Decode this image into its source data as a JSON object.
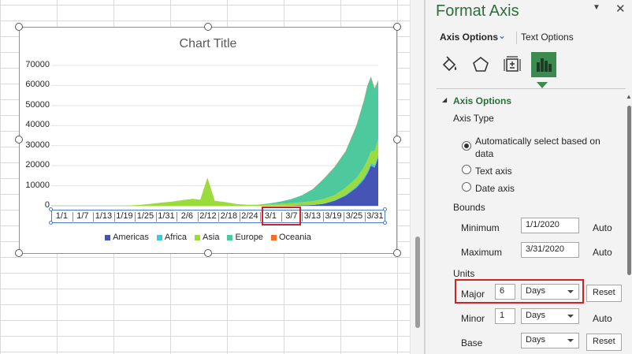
{
  "chart": {
    "title": "Chart Title",
    "y_ticks": [
      "70000",
      "60000",
      "50000",
      "40000",
      "30000",
      "20000",
      "10000",
      "0"
    ],
    "x_ticks": [
      "1/1",
      "1/7",
      "1/13",
      "1/19",
      "1/25",
      "1/31",
      "2/6",
      "2/12",
      "2/18",
      "2/24",
      "3/1",
      "3/7",
      "3/13",
      "3/19",
      "3/25",
      "3/31"
    ],
    "legend": [
      {
        "name": "Americas",
        "color": "#4655b5"
      },
      {
        "name": "Africa",
        "color": "#45c3e6"
      },
      {
        "name": "Asia",
        "color": "#9bdc3c"
      },
      {
        "name": "Europe",
        "color": "#4ec89d"
      },
      {
        "name": "Oceania",
        "color": "#f0702c"
      }
    ],
    "highlighted_ticks": [
      "3/1",
      "3/7"
    ]
  },
  "chart_data": {
    "type": "area",
    "title": "Chart Title",
    "xlabel": "",
    "ylabel": "",
    "ylim": [
      0,
      70000
    ],
    "x": [
      "1/1",
      "1/4",
      "1/7",
      "1/10",
      "1/13",
      "1/16",
      "1/19",
      "1/22",
      "1/25",
      "1/28",
      "1/31",
      "2/3",
      "2/6",
      "2/9",
      "2/11",
      "2/13",
      "2/15",
      "2/18",
      "2/21",
      "2/24",
      "2/27",
      "3/1",
      "3/4",
      "3/7",
      "3/10",
      "3/13",
      "3/16",
      "3/19",
      "3/22",
      "3/25",
      "3/27",
      "3/28",
      "3/29",
      "3/30",
      "3/31"
    ],
    "series": [
      {
        "name": "Americas",
        "values": [
          0,
          0,
          0,
          0,
          0,
          0,
          0,
          0,
          0,
          0,
          0,
          0,
          0,
          0,
          0,
          0,
          0,
          0,
          0,
          0,
          0,
          0,
          50,
          100,
          200,
          400,
          1000,
          2500,
          5000,
          9000,
          13000,
          16000,
          20000,
          19000,
          24000
        ]
      },
      {
        "name": "Africa",
        "values": [
          0,
          0,
          0,
          0,
          0,
          0,
          0,
          0,
          0,
          0,
          0,
          0,
          0,
          0,
          0,
          0,
          0,
          0,
          0,
          0,
          0,
          0,
          0,
          0,
          50,
          100,
          200,
          300,
          500,
          800,
          1000,
          1100,
          1200,
          1300,
          1400
        ]
      },
      {
        "name": "Asia",
        "values": [
          0,
          0,
          0,
          0,
          0,
          0,
          0,
          100,
          400,
          900,
          1500,
          2000,
          2800,
          3500,
          3000,
          14000,
          2500,
          1800,
          900,
          500,
          500,
          700,
          1000,
          1200,
          1500,
          1800,
          2200,
          2500,
          3500,
          4000,
          5000,
          5500,
          6000,
          7000,
          8000
        ]
      },
      {
        "name": "Europe",
        "values": [
          0,
          0,
          0,
          0,
          0,
          0,
          0,
          0,
          0,
          0,
          0,
          0,
          0,
          0,
          0,
          0,
          0,
          0,
          0,
          0,
          100,
          500,
          1000,
          2000,
          3500,
          6000,
          10000,
          14000,
          18000,
          26000,
          33000,
          37000,
          37000,
          31000,
          29000
        ]
      },
      {
        "name": "Oceania",
        "values": [
          0,
          0,
          0,
          0,
          0,
          0,
          0,
          0,
          0,
          0,
          0,
          0,
          0,
          0,
          0,
          0,
          0,
          0,
          0,
          0,
          0,
          0,
          0,
          0,
          0,
          50,
          100,
          150,
          200,
          300,
          300,
          300,
          300,
          300,
          300
        ]
      }
    ]
  },
  "pane": {
    "title": "Format Axis",
    "tab_axis_options": "Axis Options",
    "tab_text_options": "Text Options",
    "section_header": "Axis Options",
    "axis_type_label": "Axis Type",
    "radio_auto_line1": "Automatically select based on",
    "radio_auto_line2": "data",
    "radio_text": "Text axis",
    "radio_date": "Date axis",
    "bounds_label": "Bounds",
    "minimum_label": "Minimum",
    "minimum_value": "1/1/2020",
    "minimum_state": "Auto",
    "maximum_label": "Maximum",
    "maximum_value": "3/31/2020",
    "maximum_state": "Auto",
    "units_label": "Units",
    "major_label": "Major",
    "major_value": "6",
    "major_unit": "Days",
    "major_button": "Reset",
    "minor_label": "Minor",
    "minor_value": "1",
    "minor_unit": "Days",
    "minor_state": "Auto",
    "base_label": "Base",
    "base_unit": "Days",
    "base_button": "Reset"
  }
}
